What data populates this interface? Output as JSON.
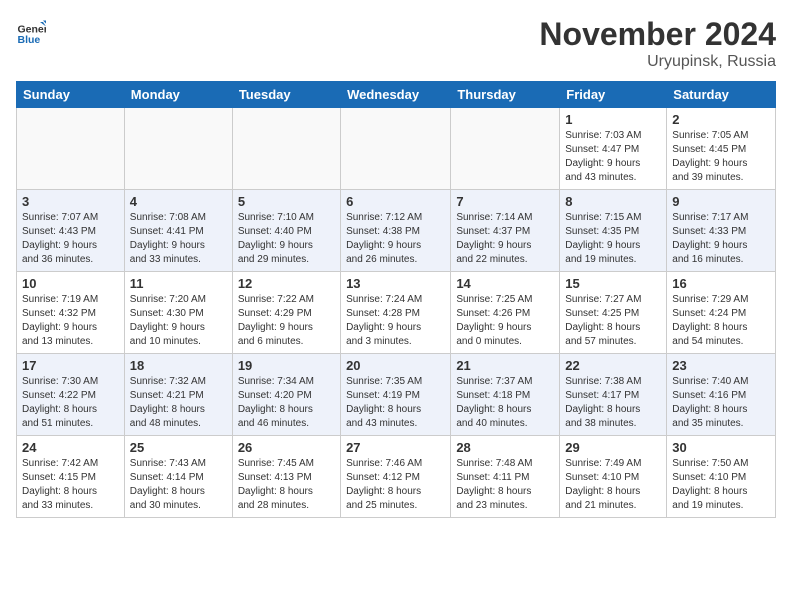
{
  "header": {
    "logo_general": "General",
    "logo_blue": "Blue",
    "month_year": "November 2024",
    "location": "Uryupinsk, Russia"
  },
  "days_of_week": [
    "Sunday",
    "Monday",
    "Tuesday",
    "Wednesday",
    "Thursday",
    "Friday",
    "Saturday"
  ],
  "weeks": [
    [
      {
        "day": "",
        "info": ""
      },
      {
        "day": "",
        "info": ""
      },
      {
        "day": "",
        "info": ""
      },
      {
        "day": "",
        "info": ""
      },
      {
        "day": "",
        "info": ""
      },
      {
        "day": "1",
        "info": "Sunrise: 7:03 AM\nSunset: 4:47 PM\nDaylight: 9 hours\nand 43 minutes."
      },
      {
        "day": "2",
        "info": "Sunrise: 7:05 AM\nSunset: 4:45 PM\nDaylight: 9 hours\nand 39 minutes."
      }
    ],
    [
      {
        "day": "3",
        "info": "Sunrise: 7:07 AM\nSunset: 4:43 PM\nDaylight: 9 hours\nand 36 minutes."
      },
      {
        "day": "4",
        "info": "Sunrise: 7:08 AM\nSunset: 4:41 PM\nDaylight: 9 hours\nand 33 minutes."
      },
      {
        "day": "5",
        "info": "Sunrise: 7:10 AM\nSunset: 4:40 PM\nDaylight: 9 hours\nand 29 minutes."
      },
      {
        "day": "6",
        "info": "Sunrise: 7:12 AM\nSunset: 4:38 PM\nDaylight: 9 hours\nand 26 minutes."
      },
      {
        "day": "7",
        "info": "Sunrise: 7:14 AM\nSunset: 4:37 PM\nDaylight: 9 hours\nand 22 minutes."
      },
      {
        "day": "8",
        "info": "Sunrise: 7:15 AM\nSunset: 4:35 PM\nDaylight: 9 hours\nand 19 minutes."
      },
      {
        "day": "9",
        "info": "Sunrise: 7:17 AM\nSunset: 4:33 PM\nDaylight: 9 hours\nand 16 minutes."
      }
    ],
    [
      {
        "day": "10",
        "info": "Sunrise: 7:19 AM\nSunset: 4:32 PM\nDaylight: 9 hours\nand 13 minutes."
      },
      {
        "day": "11",
        "info": "Sunrise: 7:20 AM\nSunset: 4:30 PM\nDaylight: 9 hours\nand 10 minutes."
      },
      {
        "day": "12",
        "info": "Sunrise: 7:22 AM\nSunset: 4:29 PM\nDaylight: 9 hours\nand 6 minutes."
      },
      {
        "day": "13",
        "info": "Sunrise: 7:24 AM\nSunset: 4:28 PM\nDaylight: 9 hours\nand 3 minutes."
      },
      {
        "day": "14",
        "info": "Sunrise: 7:25 AM\nSunset: 4:26 PM\nDaylight: 9 hours\nand 0 minutes."
      },
      {
        "day": "15",
        "info": "Sunrise: 7:27 AM\nSunset: 4:25 PM\nDaylight: 8 hours\nand 57 minutes."
      },
      {
        "day": "16",
        "info": "Sunrise: 7:29 AM\nSunset: 4:24 PM\nDaylight: 8 hours\nand 54 minutes."
      }
    ],
    [
      {
        "day": "17",
        "info": "Sunrise: 7:30 AM\nSunset: 4:22 PM\nDaylight: 8 hours\nand 51 minutes."
      },
      {
        "day": "18",
        "info": "Sunrise: 7:32 AM\nSunset: 4:21 PM\nDaylight: 8 hours\nand 48 minutes."
      },
      {
        "day": "19",
        "info": "Sunrise: 7:34 AM\nSunset: 4:20 PM\nDaylight: 8 hours\nand 46 minutes."
      },
      {
        "day": "20",
        "info": "Sunrise: 7:35 AM\nSunset: 4:19 PM\nDaylight: 8 hours\nand 43 minutes."
      },
      {
        "day": "21",
        "info": "Sunrise: 7:37 AM\nSunset: 4:18 PM\nDaylight: 8 hours\nand 40 minutes."
      },
      {
        "day": "22",
        "info": "Sunrise: 7:38 AM\nSunset: 4:17 PM\nDaylight: 8 hours\nand 38 minutes."
      },
      {
        "day": "23",
        "info": "Sunrise: 7:40 AM\nSunset: 4:16 PM\nDaylight: 8 hours\nand 35 minutes."
      }
    ],
    [
      {
        "day": "24",
        "info": "Sunrise: 7:42 AM\nSunset: 4:15 PM\nDaylight: 8 hours\nand 33 minutes."
      },
      {
        "day": "25",
        "info": "Sunrise: 7:43 AM\nSunset: 4:14 PM\nDaylight: 8 hours\nand 30 minutes."
      },
      {
        "day": "26",
        "info": "Sunrise: 7:45 AM\nSunset: 4:13 PM\nDaylight: 8 hours\nand 28 minutes."
      },
      {
        "day": "27",
        "info": "Sunrise: 7:46 AM\nSunset: 4:12 PM\nDaylight: 8 hours\nand 25 minutes."
      },
      {
        "day": "28",
        "info": "Sunrise: 7:48 AM\nSunset: 4:11 PM\nDaylight: 8 hours\nand 23 minutes."
      },
      {
        "day": "29",
        "info": "Sunrise: 7:49 AM\nSunset: 4:10 PM\nDaylight: 8 hours\nand 21 minutes."
      },
      {
        "day": "30",
        "info": "Sunrise: 7:50 AM\nSunset: 4:10 PM\nDaylight: 8 hours\nand 19 minutes."
      }
    ]
  ]
}
